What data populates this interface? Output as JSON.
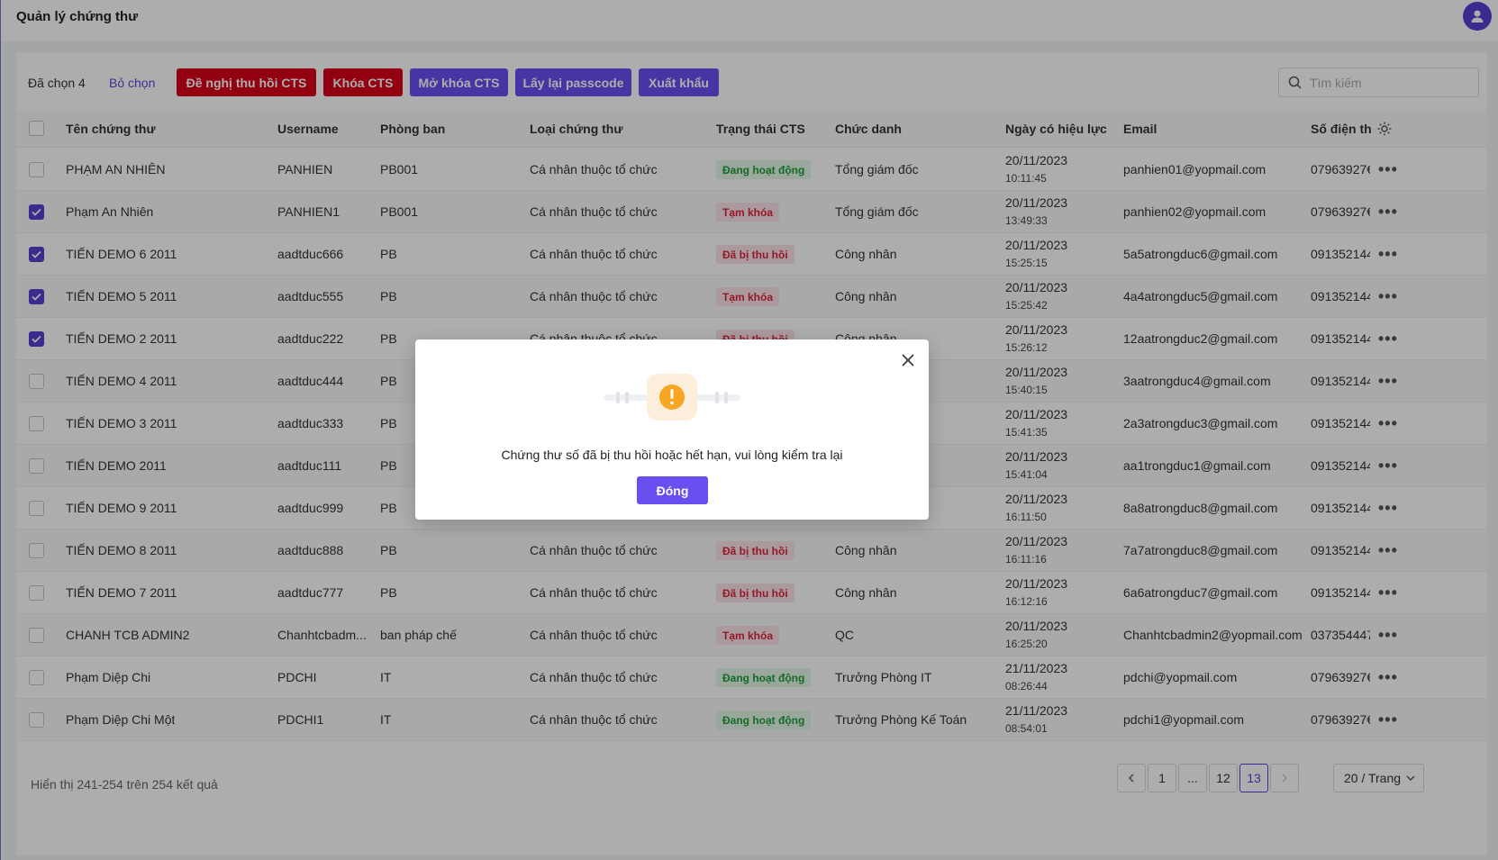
{
  "header": {
    "title": "Quản lý chứng thư"
  },
  "toolbar": {
    "selected": "Đã chọn 4",
    "deselect": "Bỏ chọn",
    "btn_revoke": "Đề nghị thu hồi CTS",
    "btn_lock": "Khóa CTS",
    "btn_unlock": "Mở khóa CTS",
    "btn_passcode": "Lấy lại passcode",
    "btn_export": "Xuất khẩu",
    "search_placeholder": "Tìm kiếm"
  },
  "columns": [
    "Tên chứng thư",
    "Username",
    "Phòng ban",
    "Loại chứng thư",
    "Trạng thái CTS",
    "Chức danh",
    "Ngày có hiệu lực",
    "Email",
    "Số điện th"
  ],
  "rows": [
    {
      "checked": false,
      "name": "PHẠM AN NHIÊN",
      "user": "PANHIEN",
      "dept": "PB001",
      "type": "Cá nhân thuộc tổ chức",
      "status": "Đang hoạt động",
      "tone": "green",
      "title": "Tổng giám đốc",
      "date": "20/11/2023",
      "time": "10:11:45",
      "email": "panhien01@yopmail.com",
      "phone": "07963927€"
    },
    {
      "checked": true,
      "name": "Phạm An Nhiên",
      "user": "PANHIEN1",
      "dept": "PB001",
      "type": "Cá nhân thuộc tổ chức",
      "status": "Tạm khóa",
      "tone": "red",
      "title": "Tổng giám đốc",
      "date": "20/11/2023",
      "time": "13:49:33",
      "email": "panhien02@yopmail.com",
      "phone": "07963927€"
    },
    {
      "checked": true,
      "name": "TIẾN DEMO 6 2011",
      "user": "aadtduc666",
      "dept": "PB",
      "type": "Cá nhân thuộc tổ chức",
      "status": "Đã bị thu hồi",
      "tone": "red",
      "title": "Công nhân",
      "date": "20/11/2023",
      "time": "15:25:15",
      "email": "5a5atrongduc6@gmail.com",
      "phone": "091352144"
    },
    {
      "checked": true,
      "name": "TIẾN DEMO 5 2011",
      "user": "aadtduc555",
      "dept": "PB",
      "type": "Cá nhân thuộc tổ chức",
      "status": "Tạm khóa",
      "tone": "red",
      "title": "Công nhân",
      "date": "20/11/2023",
      "time": "15:25:42",
      "email": "4a4atrongduc5@gmail.com",
      "phone": "091352144"
    },
    {
      "checked": true,
      "name": "TIẾN DEMO 2 2011",
      "user": "aadtduc222",
      "dept": "PB",
      "type": "Cá nhân thuộc tổ chức",
      "status": "Đã bị thu hồi",
      "tone": "red",
      "title": "Công nhân",
      "date": "20/11/2023",
      "time": "15:26:12",
      "email": "12aatrongduc2@gmail.com",
      "phone": "091352144"
    },
    {
      "checked": false,
      "name": "TIẾN DEMO 4 2011",
      "user": "aadtduc444",
      "dept": "PB",
      "type": "",
      "status": "",
      "tone": "",
      "title": "Công nhân",
      "date": "20/11/2023",
      "time": "15:40:15",
      "email": "3aatrongduc4@gmail.com",
      "phone": "091352144"
    },
    {
      "checked": false,
      "name": "TIẾN DEMO 3 2011",
      "user": "aadtduc333",
      "dept": "PB",
      "type": "",
      "status": "",
      "tone": "",
      "title": "Công nhân",
      "date": "20/11/2023",
      "time": "15:41:35",
      "email": "2a3atrongduc3@gmail.com",
      "phone": "091352144"
    },
    {
      "checked": false,
      "name": "TIẾN DEMO 2011",
      "user": "aadtduc111",
      "dept": "PB",
      "type": "",
      "status": "",
      "tone": "",
      "title": "Công nhân",
      "date": "20/11/2023",
      "time": "15:41:04",
      "email": "aa1trongduc1@gmail.com",
      "phone": "091352144"
    },
    {
      "checked": false,
      "name": "TIẾN DEMO 9 2011",
      "user": "aadtduc999",
      "dept": "PB",
      "type": "",
      "status": "",
      "tone": "",
      "title": "Công nhân",
      "date": "20/11/2023",
      "time": "16:11:50",
      "email": "8a8atrongduc8@gmail.com",
      "phone": "091352144"
    },
    {
      "checked": false,
      "name": "TIẾN DEMO 8 2011",
      "user": "aadtduc888",
      "dept": "PB",
      "type": "Cá nhân thuộc tổ chức",
      "status": "Đã bị thu hồi",
      "tone": "red",
      "title": "Công nhân",
      "date": "20/11/2023",
      "time": "16:11:16",
      "email": "7a7atrongduc8@gmail.com",
      "phone": "091352144"
    },
    {
      "checked": false,
      "name": "TIẾN DEMO 7 2011",
      "user": "aadtduc777",
      "dept": "PB",
      "type": "Cá nhân thuộc tổ chức",
      "status": "Đã bị thu hồi",
      "tone": "red",
      "title": "Công nhân",
      "date": "20/11/2023",
      "time": "16:12:16",
      "email": "6a6atrongduc7@gmail.com",
      "phone": "091352144"
    },
    {
      "checked": false,
      "name": "CHANH TCB ADMIN2",
      "user": "Chanhtcbadm...",
      "dept": "ban pháp chế",
      "type": "Cá nhân thuộc tổ chức",
      "status": "Tạm khóa",
      "tone": "red",
      "title": "QC",
      "date": "20/11/2023",
      "time": "16:25:20",
      "email": "Chanhtcbadmin2@yopmail.com",
      "phone": "037354447"
    },
    {
      "checked": false,
      "name": "Phạm Diệp Chi",
      "user": "PDCHI",
      "dept": "IT",
      "type": "Cá nhân thuộc tổ chức",
      "status": "Đang hoạt động",
      "tone": "green",
      "title": "Trưởng Phòng IT",
      "date": "21/11/2023",
      "time": "08:26:44",
      "email": "pdchi@yopmail.com",
      "phone": "07963927€"
    },
    {
      "checked": false,
      "name": "Phạm Diệp Chi Một",
      "user": "PDCHI1",
      "dept": "IT",
      "type": "Cá nhân thuộc tổ chức",
      "status": "Đang hoạt động",
      "tone": "green",
      "title": "Trưởng Phòng Kế Toán",
      "date": "21/11/2023",
      "time": "08:54:01",
      "email": "pdchi1@yopmail.com",
      "phone": "07963927€"
    }
  ],
  "footer": {
    "summary": "Hiển thị 241-254 trên 254 kết quả",
    "pages": [
      "1",
      "...",
      "12",
      "13"
    ],
    "active_page": "13",
    "page_size": "20 / Trang"
  },
  "modal": {
    "message": "Chứng thư số đã bị thu hồi hoặc hết hạn, vui lòng kiểm tra lại",
    "ok_label": "Đóng"
  },
  "colors": {
    "accent": "#6a4ef0",
    "danger": "#d9001b",
    "success": "#1f9d3a"
  }
}
